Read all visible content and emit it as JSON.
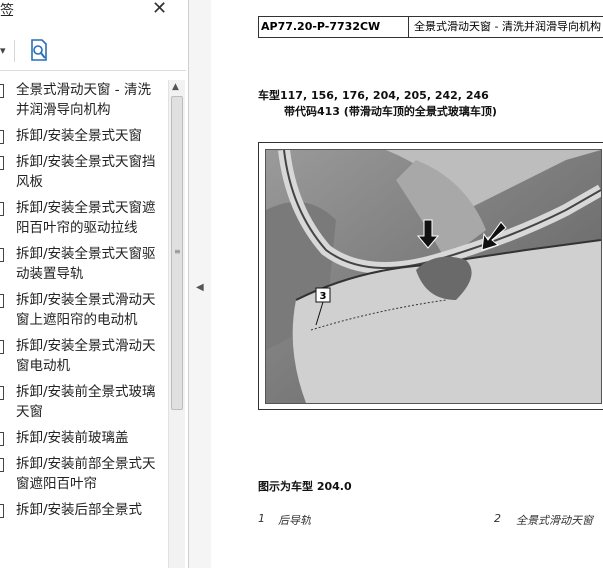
{
  "panel": {
    "title": "签",
    "close_label": "✕",
    "toolbar": {
      "dropdown_label": "▾",
      "icon": "bookmark-search-icon"
    },
    "bookmarks": [
      {
        "label": "全景式滑动天窗 - 清洗并润滑导向机构"
      },
      {
        "label": "拆卸/安装全景式天窗"
      },
      {
        "label": "拆卸/安装全景式天窗挡风板"
      },
      {
        "label": "拆卸/安装全景式天窗遮阳百叶帘的驱动拉线"
      },
      {
        "label": "拆卸/安装全景式天窗驱动装置导轨"
      },
      {
        "label": "拆卸/安装全景式滑动天窗上遮阳帘的电动机"
      },
      {
        "label": "拆卸/安装全景式滑动天窗电动机"
      },
      {
        "label": "拆卸/安装前全景式玻璃天窗"
      },
      {
        "label": "拆卸/安装前玻璃盖"
      },
      {
        "label": "拆卸/安装前部全景式天窗遮阳百叶帘"
      },
      {
        "label": "拆卸/安装后部全景式"
      }
    ],
    "scroll_up": "▲",
    "scroll_grip": "≡"
  },
  "splitter": {
    "arrow": "◀"
  },
  "document": {
    "doc_code": "AP77.20-P-7732CW",
    "doc_title": "全景式滑动天窗 - 清洗并润滑导向机构",
    "model_line": "车型117, 156, 176, 204, 205, 242, 246",
    "code_line": "带代码413 (带滑动车顶的全景式玻璃车顶)",
    "figure_label": "3",
    "caption": "图示为车型 204.0",
    "legend": [
      {
        "num": "1",
        "text": "后导轨"
      },
      {
        "num": "2",
        "text": "全景式滑动天窗"
      }
    ]
  }
}
